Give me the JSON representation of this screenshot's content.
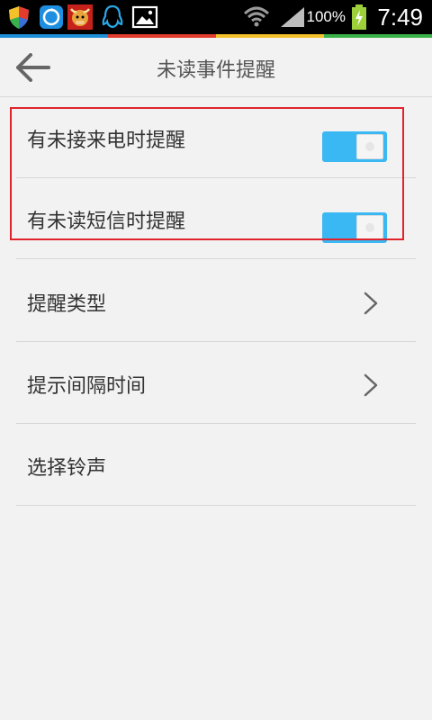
{
  "status_bar": {
    "battery_percent": "100%",
    "time": "7:49",
    "left_icons": [
      "shield-icon",
      "refresh-icon",
      "ox-mascot-icon",
      "qq-penguin-icon",
      "image-icon"
    ],
    "right_icons": [
      "wifi-icon",
      "signal-icon",
      "battery-charging-icon"
    ]
  },
  "header": {
    "title": "未读事件提醒"
  },
  "settings": {
    "missed_call": {
      "label": "有未接来电时提醒",
      "enabled": true
    },
    "unread_sms": {
      "label": "有未读短信时提醒",
      "enabled": true
    },
    "reminder_type": {
      "label": "提醒类型"
    },
    "reminder_interval": {
      "label": "提示间隔时间"
    },
    "ringtone": {
      "label": "选择铃声"
    }
  },
  "colors": {
    "toggle_on": "#3ab8f3",
    "highlight_border": "#e0242c"
  }
}
